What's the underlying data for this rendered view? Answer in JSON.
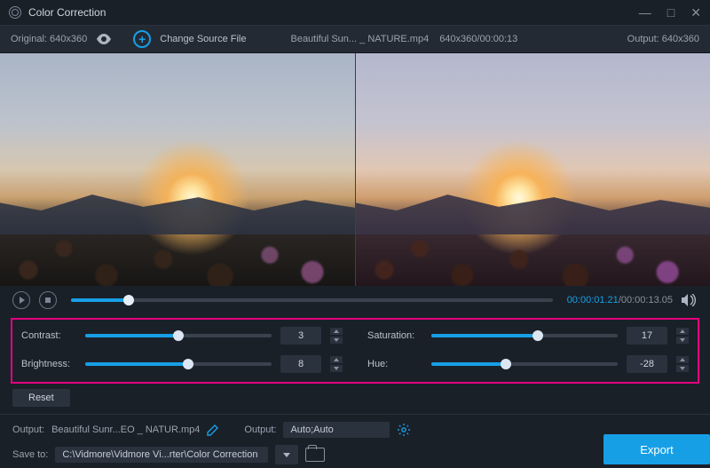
{
  "window": {
    "title": "Color Correction"
  },
  "info": {
    "original_label": "Original:",
    "original_res": "640x360",
    "change_source": "Change Source File",
    "filename": "Beautiful Sun... _ NATURE.mp4",
    "file_meta": "640x360/00:00:13",
    "output_label": "Output:",
    "output_res": "640x360"
  },
  "playback": {
    "progress_pct": 12,
    "current": "00:00:01.21",
    "duration": "00:00:13.05"
  },
  "sliders": {
    "contrast": {
      "label": "Contrast:",
      "value": 3,
      "pct": 50
    },
    "brightness": {
      "label": "Brightness:",
      "value": 8,
      "pct": 55
    },
    "saturation": {
      "label": "Saturation:",
      "value": 17,
      "pct": 57
    },
    "hue": {
      "label": "Hue:",
      "value": -28,
      "pct": 40
    }
  },
  "reset_label": "Reset",
  "output": {
    "label1": "Output:",
    "filename": "Beautiful Sunr...EO _ NATUR.mp4",
    "label2": "Output:",
    "preset": "Auto;Auto",
    "saveto_label": "Save to:",
    "saveto_path": "C:\\Vidmore\\Vidmore Vi...rter\\Color Correction"
  },
  "export_label": "Export"
}
